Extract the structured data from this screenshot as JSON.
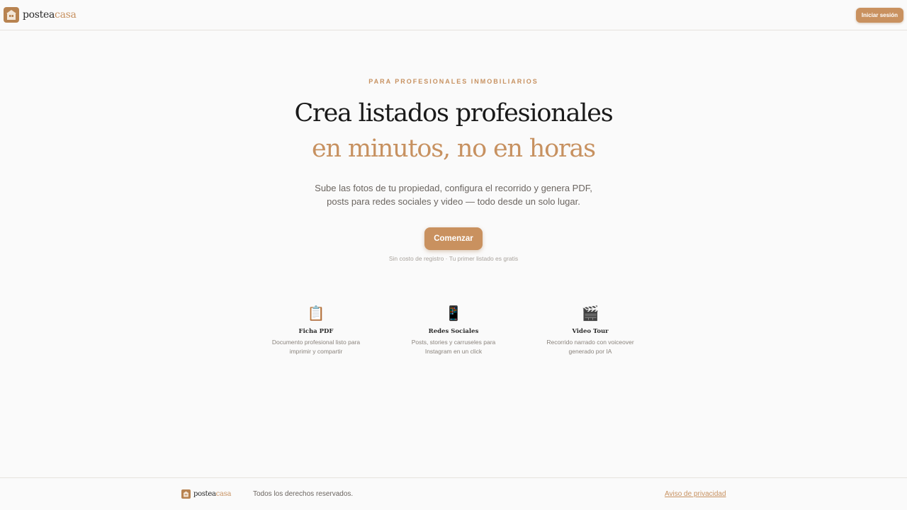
{
  "header": {
    "logo": {
      "part1": "postea",
      "part2": "casa",
      "icon": "house-logo-icon"
    },
    "login_label": "Iniciar sesión"
  },
  "hero": {
    "eyebrow": "PARA PROFESIONALES INMOBILIARIOS",
    "title_line1": "Crea listados profesionales",
    "title_line2": "en minutos, no en horas",
    "subtitle_line1": "Sube las fotos de tu propiedad, configura el recorrido y genera PDF,",
    "subtitle_line2": "posts para redes sociales y video — todo desde un solo lugar.",
    "cta_label": "Comenzar",
    "cta_note": "Sin costo de registro · Tu primer listado es gratis"
  },
  "features": [
    {
      "icon": "clipboard-icon",
      "glyph": "📋",
      "title": "Ficha PDF",
      "desc_line1": "Documento profesional listo para",
      "desc_line2": "imprimir y compartir"
    },
    {
      "icon": "mobile-phone-icon",
      "glyph": "📱",
      "title": "Redes Sociales",
      "desc_line1": "Posts, stories y carruseles para",
      "desc_line2": "Instagram en un click"
    },
    {
      "icon": "clapperboard-icon",
      "glyph": "🎬",
      "title": "Video Tour",
      "desc_line1": "Recorrido narrado con voiceover",
      "desc_line2": "generado por IA"
    }
  ],
  "footer": {
    "logo": {
      "part1": "postea",
      "part2": "casa"
    },
    "rights": "Todos los derechos reservados.",
    "privacy_label": "Aviso de privacidad"
  },
  "colors": {
    "accent": "#c9915f",
    "background": "#fafafa",
    "text": "#1a1a1a"
  }
}
